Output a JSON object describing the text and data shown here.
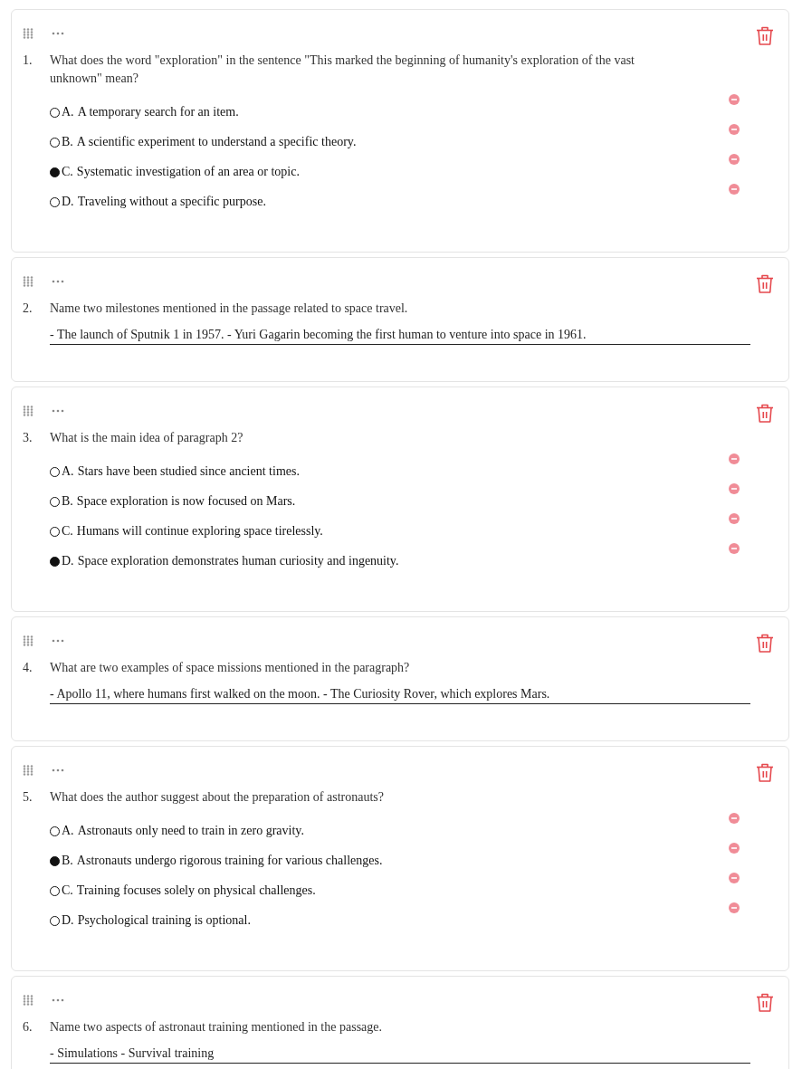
{
  "questions": [
    {
      "kind": "choice",
      "number": "1.",
      "text": "What does the word \"exploration\" in the sentence \"This marked the beginning of humanity's exploration of the vast unknown\" mean?",
      "options": [
        {
          "letter": "A.",
          "text": "A temporary search for an item.",
          "selected": false
        },
        {
          "letter": "B.",
          "text": "A scientific experiment to understand a specific theory.",
          "selected": false
        },
        {
          "letter": "C.",
          "text": "Systematic investigation of an area or topic.",
          "selected": true
        },
        {
          "letter": "D.",
          "text": "Traveling without a specific purpose.",
          "selected": false
        }
      ]
    },
    {
      "kind": "short",
      "number": "2.",
      "text": "Name two milestones mentioned in the passage related to space travel.",
      "answer": "- The launch of Sputnik 1 in 1957. - Yuri Gagarin becoming the first human to venture into space in 1961."
    },
    {
      "kind": "choice",
      "number": "3.",
      "text": "What is the main idea of paragraph 2?",
      "options": [
        {
          "letter": "A.",
          "text": "Stars have been studied since ancient times.",
          "selected": false
        },
        {
          "letter": "B.",
          "text": "Space exploration is now focused on Mars.",
          "selected": false
        },
        {
          "letter": "C.",
          "text": "Humans will continue exploring space tirelessly.",
          "selected": false
        },
        {
          "letter": "D.",
          "text": "Space exploration demonstrates human curiosity and ingenuity.",
          "selected": true
        }
      ]
    },
    {
      "kind": "short",
      "number": "4.",
      "text": "What are two examples of space missions mentioned in the paragraph?",
      "answer": "- Apollo 11, where humans first walked on the moon. - The Curiosity Rover, which explores Mars."
    },
    {
      "kind": "choice",
      "number": "5.",
      "text": "What does the author suggest about the preparation of astronauts?",
      "options": [
        {
          "letter": "A.",
          "text": "Astronauts only need to train in zero gravity.",
          "selected": false
        },
        {
          "letter": "B.",
          "text": "Astronauts undergo rigorous training for various challenges.",
          "selected": true
        },
        {
          "letter": "C.",
          "text": "Training focuses solely on physical challenges.",
          "selected": false
        },
        {
          "letter": "D.",
          "text": "Psychological training is optional.",
          "selected": false
        }
      ]
    },
    {
      "kind": "short",
      "number": "6.",
      "text": "Name two aspects of astronaut training mentioned in the passage.",
      "answer": "- Simulations - Survival training"
    }
  ]
}
